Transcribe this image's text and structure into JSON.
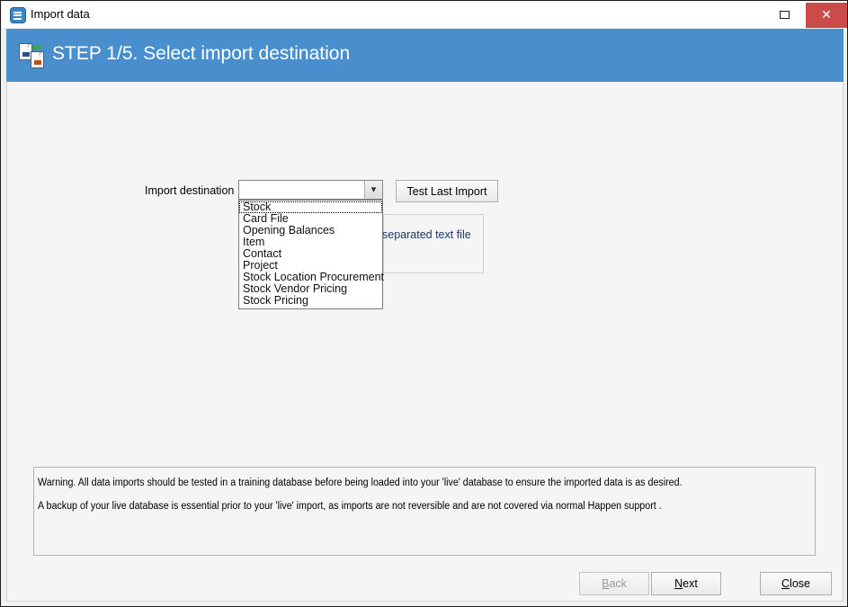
{
  "window": {
    "title": "Import data",
    "icon": "import-data-app-icon",
    "controls": {
      "maximize": "maximize-restore",
      "close": "✕"
    }
  },
  "banner": {
    "title": "STEP 1/5. Select import destination",
    "icon": "import-transfer-icon",
    "color": "#4a8fcd"
  },
  "form": {
    "destination_label": "Import destination",
    "destination_value": "",
    "dropdown_open": true,
    "dropdown_options": [
      "Stock",
      "Card File",
      "Opening Balances",
      "Item",
      "Contact",
      "Project",
      "Stock Location Procurement",
      "Stock Vendor Pricing",
      "Stock Pricing"
    ],
    "focused_option": "Stock",
    "test_last_import_label": "Test Last Import",
    "obscured_group_text": "separated text file"
  },
  "warning": {
    "line1": "Warning.  All data imports should be tested in a training database before being loaded into your 'live' database to ensure the imported data is as desired.",
    "line2": "A backup of your live database is essential prior to your 'live' import, as imports are not reversible and are not covered via normal Happen support ."
  },
  "footer": {
    "back": {
      "prefix": "",
      "mnemonic": "B",
      "suffix": "ack",
      "disabled": true
    },
    "next": {
      "prefix": "",
      "mnemonic": "N",
      "suffix": "ext",
      "disabled": false
    },
    "close": {
      "prefix": "",
      "mnemonic": "C",
      "suffix": "lose",
      "disabled": false
    }
  }
}
